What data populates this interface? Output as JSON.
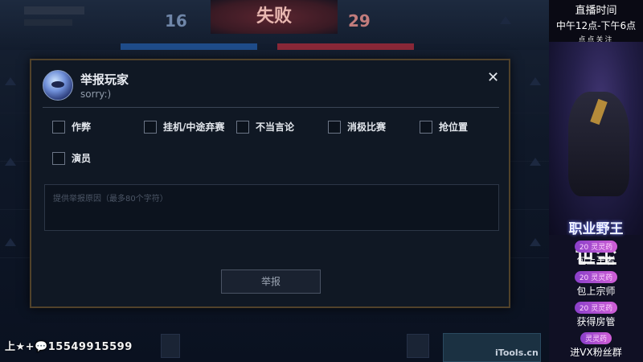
{
  "game": {
    "score_left": "16",
    "result_label": "失败",
    "score_right": "29",
    "watermark": "iTools.cn",
    "phone_overlay": "上★+💬15549915599"
  },
  "dialog": {
    "title": "举报玩家",
    "subtitle": "sorry:)",
    "close_icon": "✕",
    "options": [
      "作弊",
      "挂机/中途弃赛",
      "不当言论",
      "消极比赛",
      "抢位置",
      "演员"
    ],
    "textarea_placeholder": "提供举报原因（最多80个字符）",
    "submit_label": "举报"
  },
  "stream": {
    "live_time_label": "直播时间",
    "live_time_value": "中午12点-下午6点",
    "follow_hint": "点点关注",
    "title_line1": "职业野王",
    "title_line2": "世尘",
    "perks": [
      {
        "badge": "20 灵灵药",
        "text": "包上王者"
      },
      {
        "badge": "20 灵灵药",
        "text": "包上宗师"
      },
      {
        "badge": "20 灵灵药",
        "text": "获得房管"
      },
      {
        "badge": "灵灵药",
        "text": "进VX粉丝群"
      }
    ]
  }
}
